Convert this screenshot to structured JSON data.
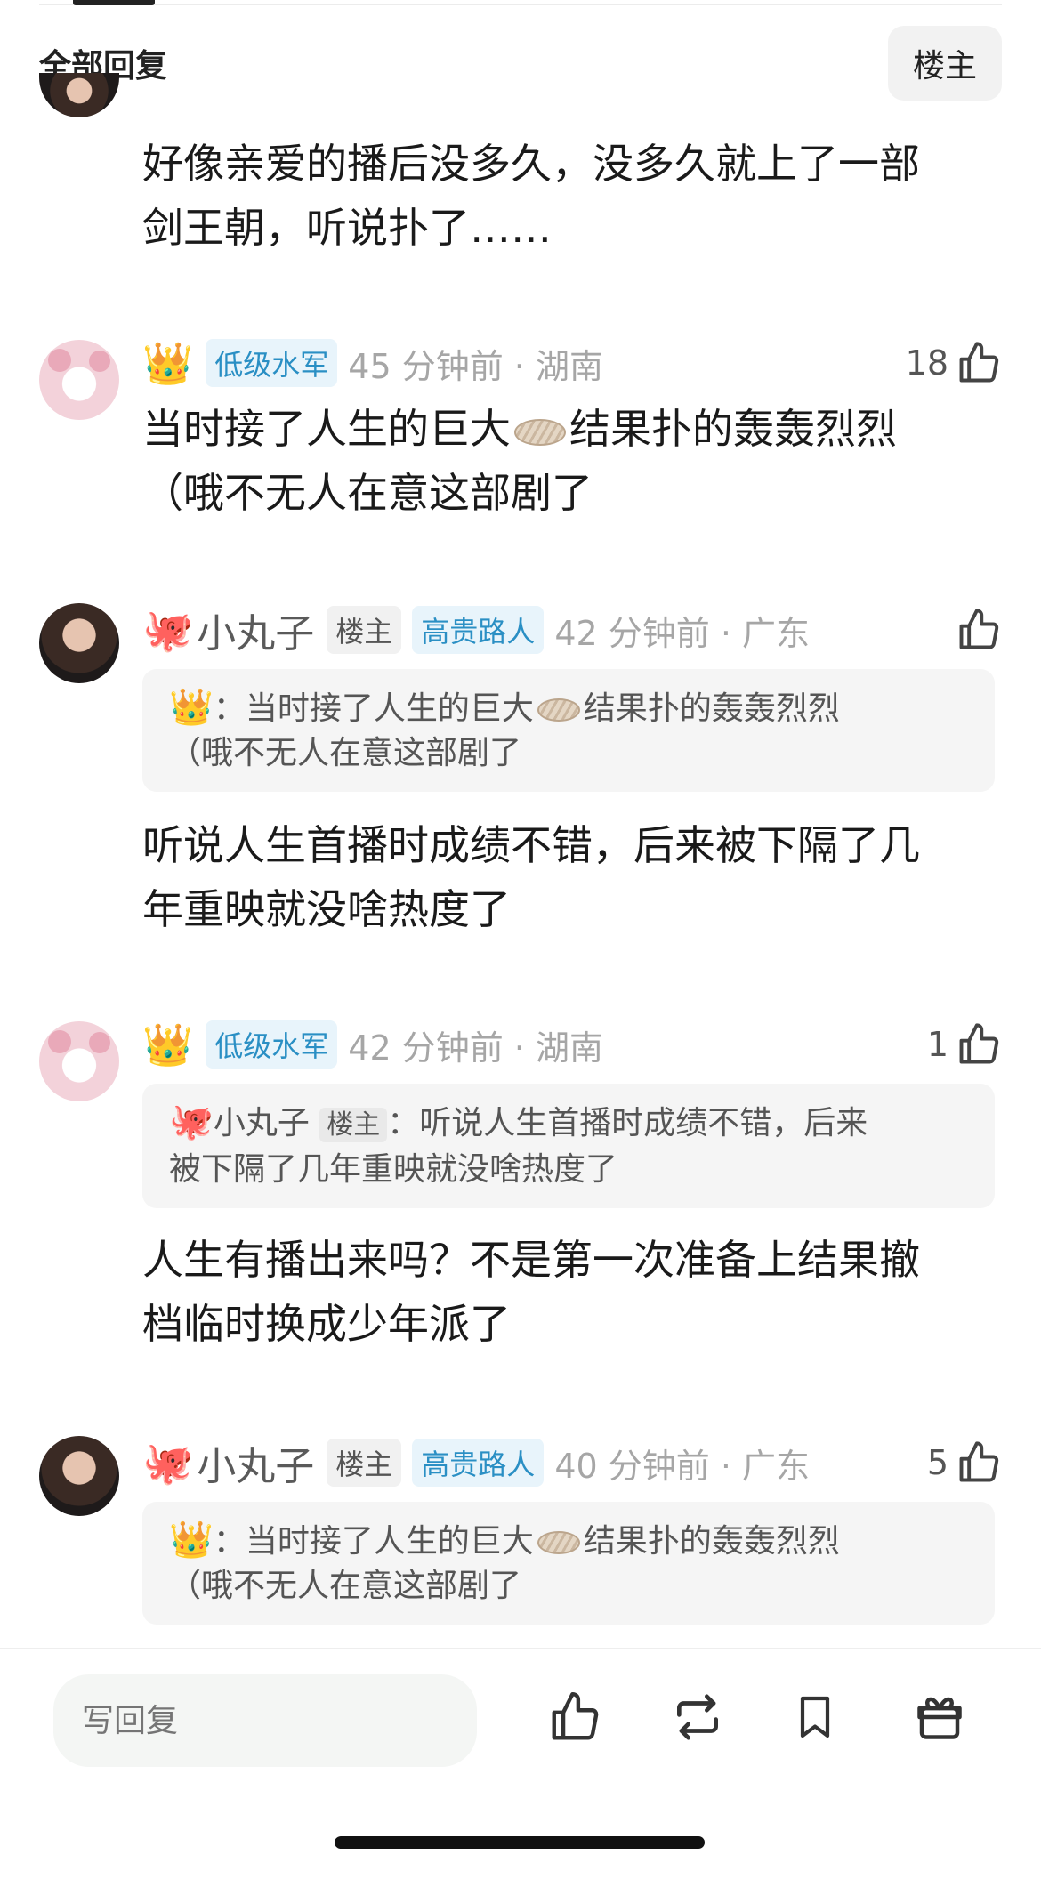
{
  "header": {
    "title": "全部回复",
    "op_filter": "楼主"
  },
  "comments": [
    {
      "text_line1": "好像亲爱的播后没多久，没多久就上了一部",
      "text_line2": "剑王朝，听说扑了……"
    },
    {
      "icon": "crown-icon",
      "badge": "低级水军",
      "time": "45 分钟前 · 湖南",
      "likes": "18",
      "text_before": "当时接了人生的巨大",
      "text_after": "结果扑的轰轰烈烈",
      "text_line2": "（哦不无人在意这部剧了"
    },
    {
      "icon": "octopus-icon",
      "username": "小丸子",
      "op_badge": "楼主",
      "badge": "高贵路人",
      "time": "42 分钟前 · 广东",
      "likes": "",
      "quote_prefix": "：当时接了人生的巨大",
      "quote_after": "结果扑的轰轰烈烈",
      "quote_line2": "（哦不无人在意这部剧了",
      "text_line1": "听说人生首播时成绩不错，后来被下隔了几",
      "text_line2": "年重映就没啥热度了"
    },
    {
      "icon": "crown-icon",
      "badge": "低级水军",
      "time": "42 分钟前 · 湖南",
      "likes": "1",
      "quote_user": "小丸子",
      "quote_op_badge": "楼主",
      "quote_text": "：听说人生首播时成绩不错，后来",
      "quote_line2": "被下隔了几年重映就没啥热度了",
      "text_line1": "人生有播出来吗？不是第一次准备上结果撤",
      "text_line2": "档临时换成少年派了"
    },
    {
      "icon": "octopus-icon",
      "username": "小丸子",
      "op_badge": "楼主",
      "badge": "高贵路人",
      "time": "40 分钟前 · 广东",
      "likes": "5",
      "quote_prefix": "：当时接了人生的巨大",
      "quote_after": "结果扑的轰轰烈烈",
      "quote_line2": "（哦不无人在意这部剧了"
    }
  ],
  "bottom_bar": {
    "reply_placeholder": "写回复",
    "icons": [
      "thumbs-up-icon",
      "repost-icon",
      "bookmark-icon",
      "gift-icon"
    ]
  },
  "colors": {
    "level_badge_text": "#2a8fc4",
    "level_badge_bg": "#e8f4fb",
    "muted": "#a6a6a6"
  }
}
